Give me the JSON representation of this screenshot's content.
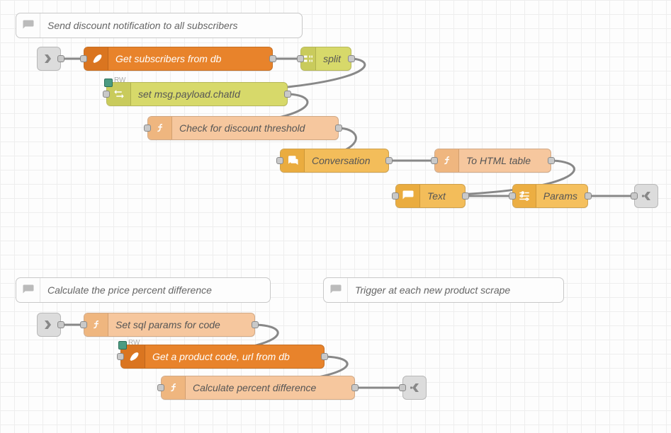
{
  "flow1": {
    "comment": "Send discount notification to all subscribers",
    "nodes": {
      "get_subs": {
        "label": "Get subscribers from db"
      },
      "split": {
        "label": "split"
      },
      "set_chatid": {
        "label": "set msg.payload.chatId",
        "badge": "RW"
      },
      "check_thr": {
        "label": "Check for discount threshold"
      },
      "conv": {
        "label": "Conversation"
      },
      "to_html": {
        "label": "To HTML table"
      },
      "text": {
        "label": "Text"
      },
      "params": {
        "label": "Params"
      }
    }
  },
  "flow2": {
    "comment": "Calculate the price percent difference",
    "nodes": {
      "set_sql": {
        "label": "Set sql params for code"
      },
      "get_prod": {
        "label": "Get a product code, url from db",
        "badge": "RW"
      },
      "calc": {
        "label": "Calculate percent difference"
      }
    }
  },
  "flow3": {
    "comment": "Trigger at each new product scrape"
  }
}
